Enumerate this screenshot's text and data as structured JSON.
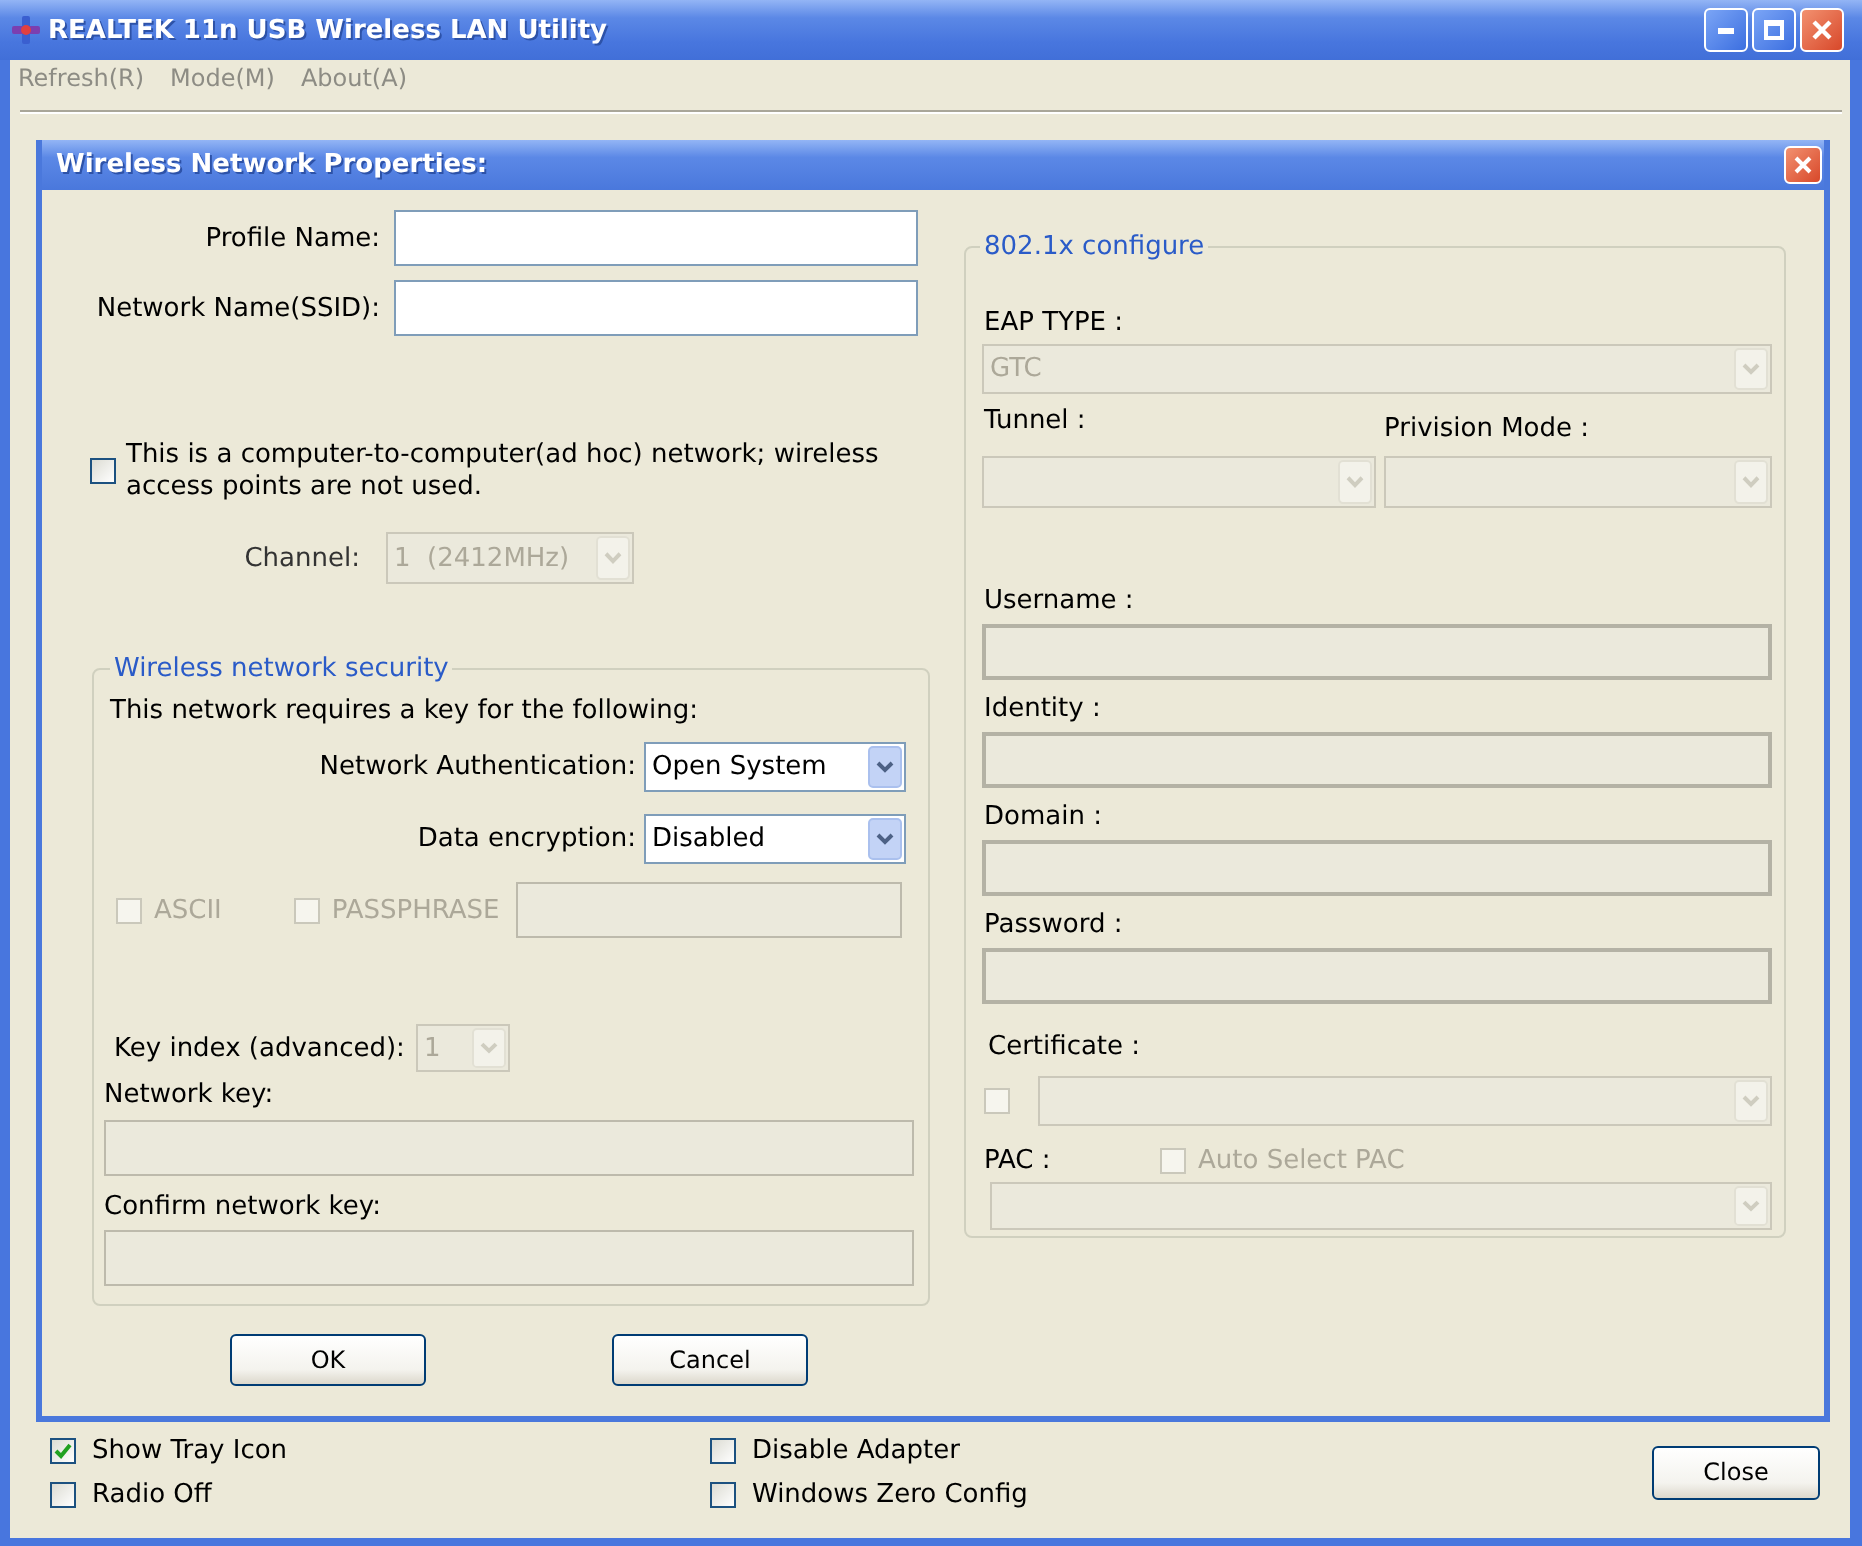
{
  "window": {
    "title": "REALTEK 11n USB Wireless LAN Utility"
  },
  "menu": [
    {
      "label": "Refresh(R)",
      "disabled": true
    },
    {
      "label": "Mode(M)",
      "disabled": true
    },
    {
      "label": "About(A)",
      "disabled": true
    }
  ],
  "dialog": {
    "title": "Wireless Network Properties:",
    "fields": [
      {
        "label": "Profile Name:",
        "disabled": false
      },
      {
        "label": "Network Name(SSID):",
        "disabled": false
      }
    ],
    "adhoc": {
      "label": "This is a computer-to-computer(ad hoc) network; wireless access points are not used.",
      "checked": false
    },
    "channel": {
      "label": "Channel:",
      "value": "1  (2412MHz)",
      "disabled": true
    },
    "security": {
      "title": "Wireless network security",
      "intro": "This network requires a key for the following:",
      "selects": [
        {
          "label": "Network Authentication:",
          "value": "Open System",
          "disabled": false
        },
        {
          "label": "Data encryption:",
          "value": "Disabled",
          "disabled": false
        }
      ],
      "options": [
        {
          "label": "ASCII",
          "checked": false,
          "disabled": true
        },
        {
          "label": "PASSPHRASE",
          "checked": false,
          "disabled": true
        }
      ],
      "passphrase_field": {
        "disabled": true
      },
      "key_index": {
        "label": "Key index (advanced):",
        "value": "1",
        "disabled": true
      },
      "keys": [
        {
          "label": "Network key:",
          "disabled": true
        },
        {
          "label": "Confirm network key:",
          "disabled": true
        }
      ]
    },
    "eap": {
      "title": "802.1x configure",
      "eap_type": {
        "label": "EAP TYPE :",
        "value": "GTC",
        "disabled": true
      },
      "tunnel": {
        "label": "Tunnel :",
        "disabled": true
      },
      "provision_mode": {
        "label": "Privision Mode :",
        "disabled": true
      },
      "fields": [
        {
          "label": "Username :",
          "disabled": true
        },
        {
          "label": "Identity :",
          "disabled": true
        },
        {
          "label": "Domain :",
          "disabled": true
        },
        {
          "label": "Password :",
          "disabled": true
        }
      ],
      "certificate": {
        "label": "Certificate :",
        "checkbox": {
          "checked": false,
          "disabled": true
        },
        "select": {
          "disabled": true
        }
      },
      "pac": {
        "label": "PAC :",
        "auto_select": {
          "label": "Auto Select PAC",
          "checked": false,
          "disabled": true
        },
        "select": {
          "disabled": true
        }
      }
    },
    "buttons": [
      {
        "label": "OK"
      },
      {
        "label": "Cancel"
      }
    ]
  },
  "options": [
    {
      "label": "Show Tray Icon",
      "checked": true
    },
    {
      "label": "Radio Off",
      "checked": false
    },
    {
      "label": "Disable Adapter",
      "checked": false
    },
    {
      "label": "Windows Zero Config",
      "checked": false
    }
  ],
  "close_button": {
    "label": "Close"
  }
}
